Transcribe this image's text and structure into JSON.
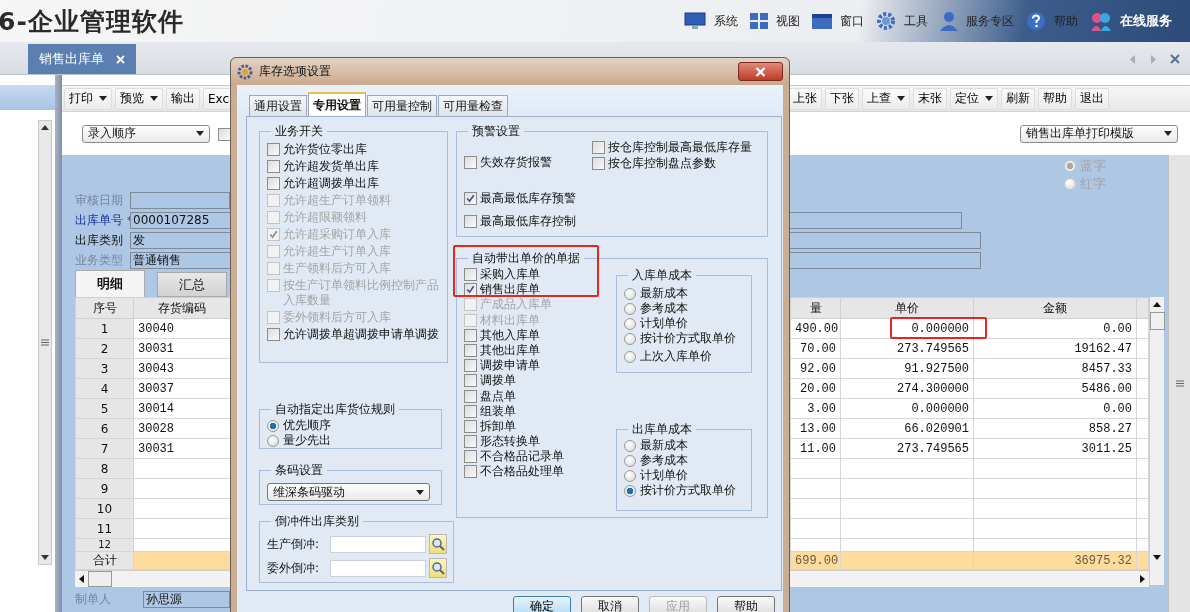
{
  "app": {
    "title": "6-企业管理软件",
    "menu": [
      {
        "label": "系统"
      },
      {
        "label": "视图"
      },
      {
        "label": "窗口"
      },
      {
        "label": "工具"
      },
      {
        "label": "服务专区"
      },
      {
        "label": "帮助"
      },
      {
        "label": "在线服务"
      }
    ]
  },
  "doc_tabs": [
    {
      "label": "销售出库单",
      "selected": true
    }
  ],
  "toolbar": {
    "left": [
      {
        "label": "打印",
        "dropdown": true
      },
      {
        "label": "预览",
        "dropdown": true
      },
      {
        "label": "输出",
        "dropdown": false
      },
      {
        "label": "Exc",
        "dropdown": false
      }
    ],
    "right": [
      {
        "label": "上张",
        "dropdown": false
      },
      {
        "label": "下张",
        "dropdown": false
      },
      {
        "label": "上查",
        "dropdown": true
      },
      {
        "label": "末张",
        "dropdown": false
      },
      {
        "label": "定位",
        "dropdown": true
      },
      {
        "label": "刷新",
        "dropdown": false
      },
      {
        "label": "帮助",
        "dropdown": false
      },
      {
        "label": "退出",
        "dropdown": false
      }
    ]
  },
  "sort_select": "录入顺序",
  "options_checkbox": {
    "checked": false
  },
  "print_template": "销售出库单打印模版",
  "color_mode": [
    {
      "label": "蓝字",
      "selected": true
    },
    {
      "label": "红字",
      "selected": false
    }
  ],
  "header_fields": [
    {
      "label": "审核日期",
      "kind": "muted"
    },
    {
      "label": "出库单号",
      "kind": "key",
      "marker": "*",
      "value": "0000107285"
    },
    {
      "label": "出库类别",
      "kind": "normal",
      "value": "发"
    },
    {
      "label": "业务类型",
      "kind": "muted",
      "value": "普通销售"
    }
  ],
  "detail_tabs": [
    {
      "label": "明细",
      "selected": true
    },
    {
      "label": "汇总",
      "selected": false
    }
  ],
  "grid": {
    "columns": [
      "序号",
      "存货编码",
      "量",
      "单价",
      "金额"
    ],
    "rows": [
      [
        "1",
        "30040",
        "490.00",
        "0.000000",
        "0.00"
      ],
      [
        "2",
        "30031",
        "70.00",
        "273.749565",
        "19162.47"
      ],
      [
        "3",
        "30043",
        "92.00",
        "91.927500",
        "8457.33"
      ],
      [
        "4",
        "30037",
        "20.00",
        "274.300000",
        "5486.00"
      ],
      [
        "5",
        "30014",
        "3.00",
        "0.000000",
        "0.00"
      ],
      [
        "6",
        "30028",
        "13.00",
        "66.020901",
        "858.27"
      ],
      [
        "7",
        "30031",
        "11.00",
        "273.749565",
        "3011.25"
      ],
      [
        "8"
      ],
      [
        "9"
      ],
      [
        "10"
      ],
      [
        "11"
      ],
      [
        "12"
      ]
    ],
    "total": {
      "label": "合计",
      "quantity": "699.00",
      "amount": "36975.32"
    }
  },
  "creator": {
    "label": "制单人",
    "value": "孙思源"
  },
  "dialog": {
    "title": "库存选项设置",
    "tabs": [
      {
        "label": "通用设置",
        "selected": false
      },
      {
        "label": "专用设置",
        "selected": true
      },
      {
        "label": "可用量控制",
        "selected": false
      },
      {
        "label": "可用量检查",
        "selected": false
      }
    ],
    "business_switches": {
      "title": "业务开关",
      "items": [
        {
          "label": "允许货位零出库",
          "checked": false,
          "disabled": false
        },
        {
          "label": "允许超发货单出库",
          "checked": false,
          "disabled": false
        },
        {
          "label": "允许超调拨单出库",
          "checked": false,
          "disabled": false
        },
        {
          "label": "允许超生产订单领料",
          "checked": false,
          "disabled": true
        },
        {
          "label": "允许超限额领料",
          "checked": false,
          "disabled": true
        },
        {
          "label": "允许超采购订单入库",
          "checked": true,
          "disabled": true
        },
        {
          "label": "允许超生产订单入库",
          "checked": false,
          "disabled": true
        },
        {
          "label": "生产领料后方可入库",
          "checked": false,
          "disabled": true
        },
        {
          "label": "按生产订单领料比例控制产品入库数量",
          "checked": false,
          "disabled": true
        },
        {
          "label": "委外领料后方可入库",
          "checked": false,
          "disabled": true
        },
        {
          "label": "允许调拨单超调拨申请单调拨",
          "checked": false,
          "disabled": false
        }
      ]
    },
    "location_rule": {
      "title": "自动指定出库货位规则",
      "options": [
        {
          "label": "优先顺序",
          "selected": true
        },
        {
          "label": "量少先出",
          "selected": false
        }
      ]
    },
    "barcode": {
      "title": "条码设置",
      "value": "维深条码驱动"
    },
    "backflush": {
      "title": "倒冲件出库类别",
      "fields": [
        {
          "label": "生产倒冲:"
        },
        {
          "label": "委外倒冲:"
        }
      ]
    },
    "warning": {
      "title": "预警设置",
      "items_left": [
        {
          "label": "失效存货报警",
          "checked": false
        },
        {
          "label": "最高最低库存预警",
          "checked": true
        },
        {
          "label": "最高最低库存控制",
          "checked": false
        }
      ],
      "items_right": [
        {
          "label": "按仓库控制最高最低库存量",
          "checked": false
        },
        {
          "label": "按仓库控制盘点参数",
          "checked": false
        }
      ]
    },
    "auto_price": {
      "title": "自动带出单价的单据",
      "items": [
        {
          "label": "采购入库单",
          "checked": false,
          "disabled": false
        },
        {
          "label": "销售出库单",
          "checked": true,
          "disabled": false
        },
        {
          "label": "产成品入库单",
          "checked": false,
          "disabled": true
        },
        {
          "label": "材料出库单",
          "checked": false,
          "disabled": true
        },
        {
          "label": "其他入库单",
          "checked": false,
          "disabled": false
        },
        {
          "label": "其他出库单",
          "checked": false,
          "disabled": false
        },
        {
          "label": "调拨申请单",
          "checked": false,
          "disabled": false
        },
        {
          "label": "调拨单",
          "checked": false,
          "disabled": false
        },
        {
          "label": "盘点单",
          "checked": false,
          "disabled": false
        },
        {
          "label": "组装单",
          "checked": false,
          "disabled": false
        },
        {
          "label": "拆卸单",
          "checked": false,
          "disabled": false
        },
        {
          "label": "形态转换单",
          "checked": false,
          "disabled": false
        },
        {
          "label": "不合格品记录单",
          "checked": false,
          "disabled": false
        },
        {
          "label": "不合格品处理单",
          "checked": false,
          "disabled": false
        }
      ]
    },
    "in_cost": {
      "title": "入库单成本",
      "options": [
        {
          "label": "最新成本",
          "selected": false
        },
        {
          "label": "参考成本",
          "selected": false
        },
        {
          "label": "计划单价",
          "selected": false
        },
        {
          "label": "按计价方式取单价",
          "selected": false
        },
        {
          "label": "上次入库单价",
          "selected": false
        }
      ]
    },
    "out_cost": {
      "title": "出库单成本",
      "options": [
        {
          "label": "最新成本",
          "selected": false
        },
        {
          "label": "参考成本",
          "selected": false
        },
        {
          "label": "计划单价",
          "selected": false
        },
        {
          "label": "按计价方式取单价",
          "selected": true
        }
      ]
    },
    "buttons": [
      {
        "label": "确定",
        "kind": "default"
      },
      {
        "label": "取消",
        "kind": "normal"
      },
      {
        "label": "应用",
        "kind": "disabled"
      },
      {
        "label": "帮助",
        "kind": "normal"
      }
    ]
  }
}
